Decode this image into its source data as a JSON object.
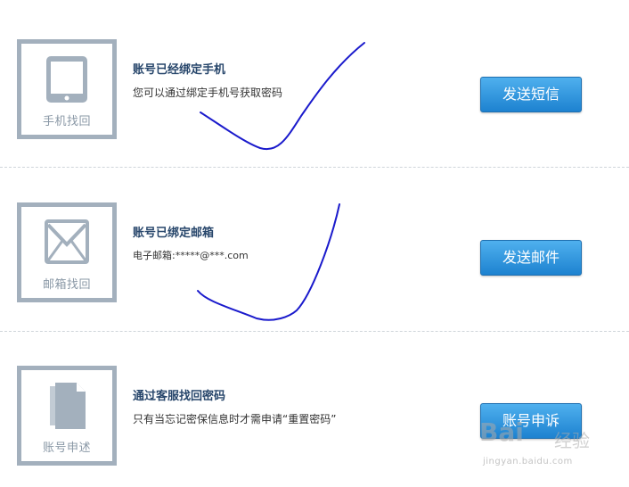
{
  "sections": [
    {
      "icon": "tablet-icon",
      "icon_caption": "手机找回",
      "title": "账号已经绑定手机",
      "description": "您可以通过绑定手机号获取密码",
      "button_label": "发送短信"
    },
    {
      "icon": "mail-envelope-icon",
      "icon_caption": "邮箱找回",
      "title": "账号已绑定邮箱",
      "description": "电子邮箱:*****@***.com",
      "button_label": "发送邮件"
    },
    {
      "icon": "document-icon",
      "icon_caption": "账号申述",
      "title": "通过客服找回密码",
      "description": "只有当忘记密保信息时才需申请“重置密码”",
      "button_label": "账号申诉"
    }
  ],
  "watermark": {
    "brand": "Bai",
    "brand_suffix": "经验",
    "url": "jingyan.baidu.com"
  },
  "colors": {
    "icon_border": "#a3b0bd",
    "title": "#27466b",
    "button": "#2a8ad6",
    "scribble": "#1a1acc"
  }
}
